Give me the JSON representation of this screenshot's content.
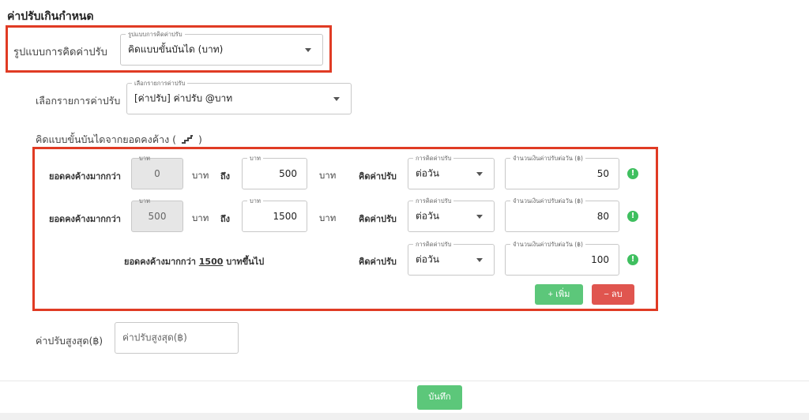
{
  "page_title": "ค่าปรับเกินกำหนด",
  "calc_method": {
    "label": "รูปแบบการคิดค่าปรับ",
    "legend": "รูปแบบการคิดค่าปรับ",
    "value": "คิดแบบขั้นบันได (บาท)"
  },
  "fine_item": {
    "label": "เลือกรายการค่าปรับ",
    "legend": "เลือกรายการค่าปรับ",
    "value": "[ค่าปรับ] ค่าปรับ @บาท"
  },
  "tier_section": {
    "heading": "คิดแบบขั้นบันไดจากยอดคงค้าง (",
    "heading_close": ")"
  },
  "tiers": [
    {
      "outstanding_label": "ยอดคงค้างมากกว่า",
      "from_legend": "บาท",
      "from_value": "0",
      "unit_1": "บาท",
      "to_label": "ถึง",
      "to_legend": "บาท",
      "to_value": "500",
      "unit_2": "บาท",
      "calc_label": "คิดค่าปรับ",
      "method_legend": "การคิดค่าปรับ",
      "method_value": "ต่อวัน",
      "amount_legend": "จำนวนเงินค่าปรับต่อวัน (฿)",
      "amount_value": "50",
      "info": "!"
    },
    {
      "outstanding_label": "ยอดคงค้างมากกว่า",
      "from_legend": "บาท",
      "from_value": "500",
      "unit_1": "บาท",
      "to_label": "ถึง",
      "to_legend": "บาท",
      "to_value": "1500",
      "unit_2": "บาท",
      "calc_label": "คิดค่าปรับ",
      "method_legend": "การคิดค่าปรับ",
      "method_value": "ต่อวัน",
      "amount_legend": "จำนวนเงินค่าปรับต่อวัน (฿)",
      "amount_value": "80",
      "info": "!"
    }
  ],
  "last_tier": {
    "prefix": "ยอดคงค้างมากกว่า ",
    "amount": "1500",
    "suffix": " บาทขึ้นไป",
    "calc_label": "คิดค่าปรับ",
    "method_legend": "การคิดค่าปรับ",
    "method_value": "ต่อวัน",
    "amount_legend": "จำนวนเงินค่าปรับต่อวัน (฿)",
    "amount_value": "100",
    "info": "!"
  },
  "buttons": {
    "add": "+  เพิ่ม",
    "remove": "−  ลบ",
    "save": "บันทึก"
  },
  "max_fine": {
    "label": "ค่าปรับสูงสุด(฿)",
    "placeholder": "ค่าปรับสูงสุด(฿)"
  },
  "colors": {
    "highlight": "#e03b24",
    "green": "#5cc77a",
    "red": "#e0554f"
  }
}
